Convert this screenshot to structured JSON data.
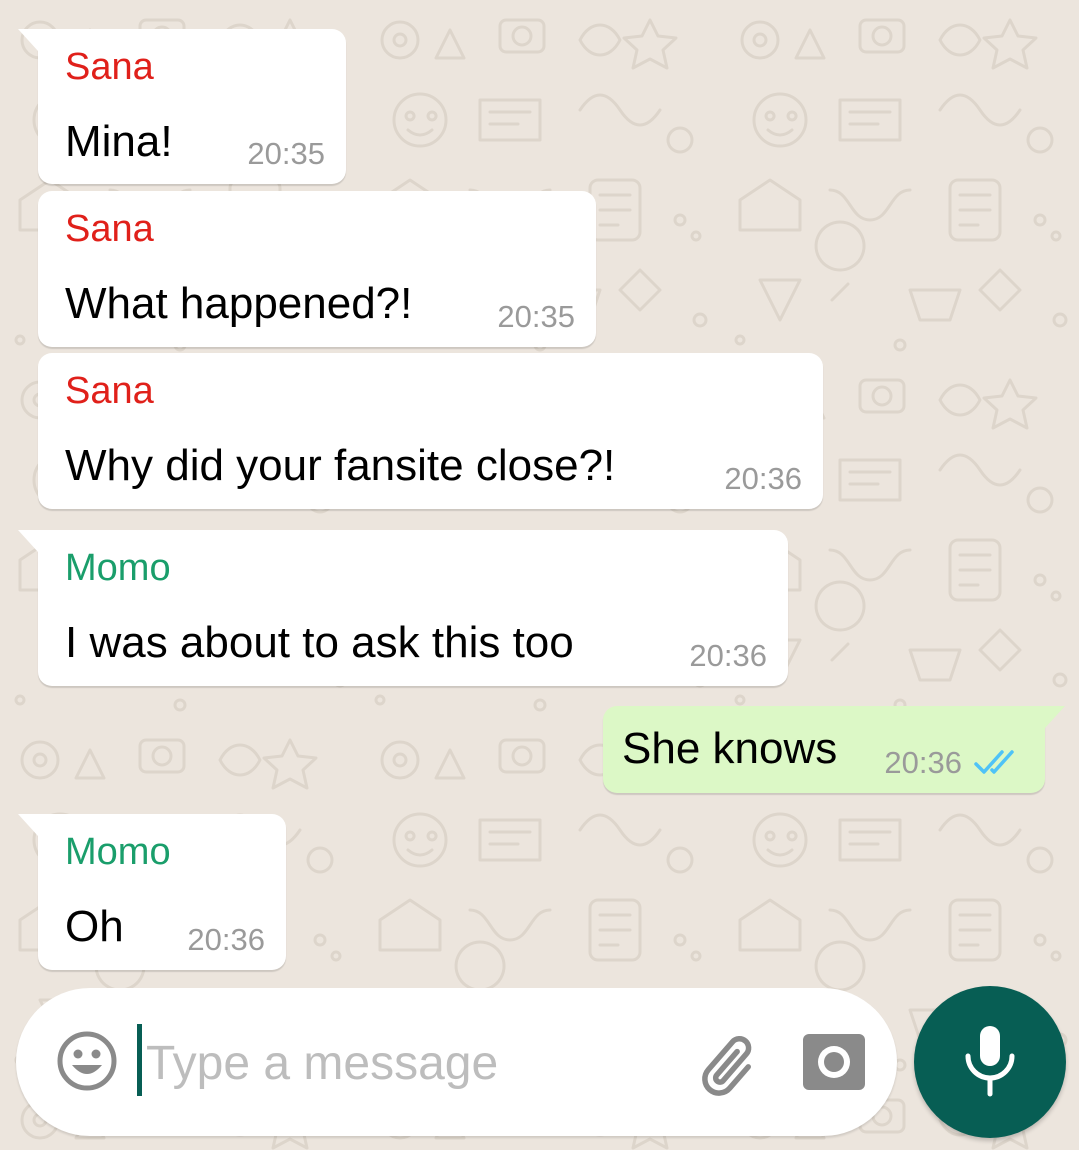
{
  "colors": {
    "chat_background": "#ece5dd",
    "incoming_bubble": "#ffffff",
    "outgoing_bubble": "#dcf8c6",
    "time_text": "#9a9a9a",
    "read_ticks": "#4fc3f7",
    "accent": "#075e54"
  },
  "messages": [
    {
      "sender": "Sana",
      "sender_color": "#e0201a",
      "text": "Mina!",
      "time": "20:35",
      "direction": "incoming"
    },
    {
      "sender": "Sana",
      "sender_color": "#e0201a",
      "text": "What happened?!",
      "time": "20:35",
      "direction": "incoming"
    },
    {
      "sender": "Sana",
      "sender_color": "#e0201a",
      "text": "Why did your fansite close?!",
      "time": "20:36",
      "direction": "incoming"
    },
    {
      "sender": "Momo",
      "sender_color": "#1a9e6b",
      "text": "I was about to ask this too",
      "time": "20:36",
      "direction": "incoming"
    },
    {
      "sender": "",
      "text": "She knows",
      "time": "20:36",
      "direction": "outgoing",
      "status_icon": "double-check-read-icon"
    },
    {
      "sender": "Momo",
      "sender_color": "#1a9e6b",
      "text": "Oh",
      "time": "20:36",
      "direction": "incoming"
    }
  ],
  "composer": {
    "placeholder": "Type a message",
    "value": "",
    "emoji_icon": "emoji-icon",
    "attach_icon": "paperclip-icon",
    "camera_icon": "camera-icon",
    "send_icon": "microphone-icon"
  }
}
